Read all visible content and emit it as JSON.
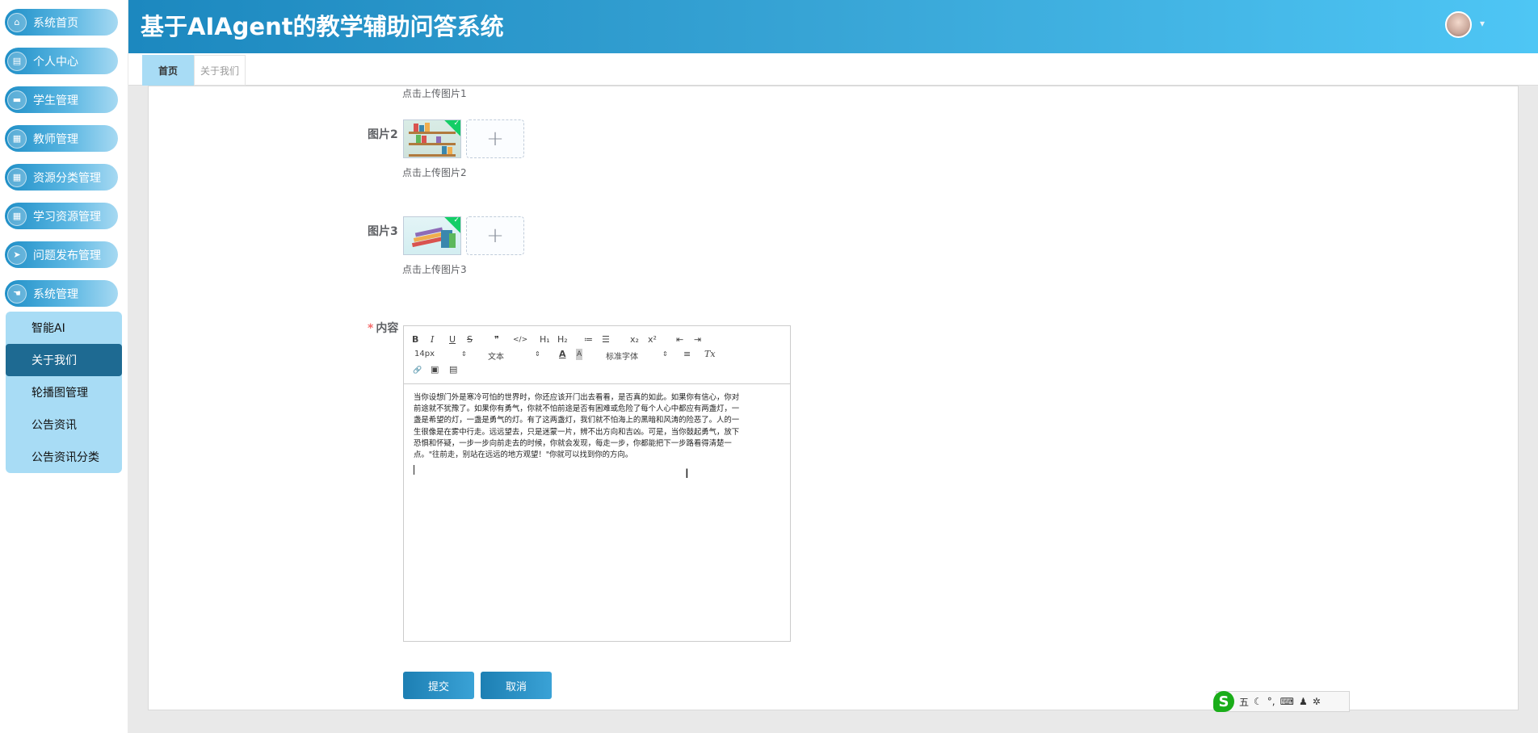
{
  "app": {
    "title": "基于AIAgent的教学辅助问答系统"
  },
  "sidebar": {
    "items": [
      {
        "label": "系统首页",
        "icon": "home-icon"
      },
      {
        "label": "个人中心",
        "icon": "profile-card-icon"
      },
      {
        "label": "学生管理",
        "icon": "briefcase-icon"
      },
      {
        "label": "教师管理",
        "icon": "grid-icon"
      },
      {
        "label": "资源分类管理",
        "icon": "grid-icon"
      },
      {
        "label": "学习资源管理",
        "icon": "grid-icon"
      },
      {
        "label": "问题发布管理",
        "icon": "send-icon"
      },
      {
        "label": "系统管理",
        "icon": "settings-hand-icon"
      }
    ],
    "submenu": [
      {
        "label": "智能AI",
        "active": false
      },
      {
        "label": "关于我们",
        "active": true
      },
      {
        "label": "轮播图管理",
        "active": false
      },
      {
        "label": "公告资讯",
        "active": false
      },
      {
        "label": "公告资讯分类",
        "active": false
      }
    ]
  },
  "header": {
    "avatar_caret": "▾"
  },
  "tabs": [
    {
      "label": "首页",
      "active": true
    },
    {
      "label": "关于我们",
      "active": false
    }
  ],
  "form": {
    "hint_picture1": "点击上传图片1",
    "picture2_label": "图片2",
    "hint_picture2": "点击上传图片2",
    "picture3_label": "图片3",
    "hint_picture3": "点击上传图片3",
    "content_label": "内容",
    "required_mark": "*",
    "upload_plus": "+"
  },
  "editor": {
    "toolbar": {
      "bold": "B",
      "italic": "I",
      "underline": "U",
      "strike": "S",
      "blockquote": "❞",
      "code": "</>",
      "h1": "H₁",
      "h2": "H₂",
      "ordered_list": "≔",
      "bullet_list": "☰",
      "subscript": "x₂",
      "superscript": "x²",
      "outdent": "⇤",
      "indent": "⇥",
      "size_value": "14px",
      "format_value": "文本",
      "color": "A",
      "background": "A",
      "font_value": "标准字体",
      "align": "≡",
      "clean": "Tx",
      "link": "🔗",
      "image": "▣",
      "video": "▤"
    },
    "content_lines": [
      "当你设想门外是寒冷可怕的世界时，你还应该开门出去看看，是否真的如此。如果你有信心，你对",
      "前途就不犹豫了。如果你有勇气，你就不怕前途是否有困难或危险了每个人心中都应有两盏灯，一",
      "盏是希望的灯，一盏是勇气的灯。有了这两盏灯，我们就不怕海上的黑暗和风涛的险恶了。人的一",
      "生很像是在雾中行走。远远望去，只是迷蒙一片，辨不出方向和吉凶。可是，当你鼓起勇气，放下",
      "恐惧和怀疑，一步一步向前走去的时候，你就会发现，每走一步，你都能把下一步路看得清楚一",
      "点。\"往前走，别站在远远的地方观望！\"你就可以找到你的方向。"
    ]
  },
  "buttons": {
    "submit": "提交",
    "cancel": "取消"
  },
  "ime": {
    "logo": "S",
    "mode": "五",
    "moon": "☾",
    "punct": "°,",
    "keyboard": "⌨",
    "user": "♟",
    "more": "✲"
  }
}
